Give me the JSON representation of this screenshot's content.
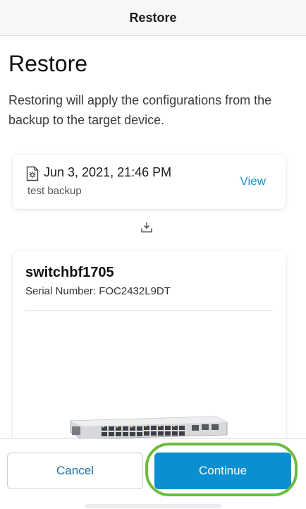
{
  "header": {
    "title": "Restore"
  },
  "page": {
    "title": "Restore",
    "description": "Restoring will apply the configurations from the backup to the target device."
  },
  "backup": {
    "date": "Jun 3, 2021, 21:46 PM",
    "name": "test backup",
    "view_label": "View",
    "icon": "document-icon"
  },
  "device": {
    "name": "switchbf1705",
    "serial": "Serial Number: FOC2432L9DT"
  },
  "footer": {
    "cancel_label": "Cancel",
    "continue_label": "Continue"
  },
  "colors": {
    "accent": "#0a8fd0",
    "link": "#1b8fc7",
    "highlight": "#6cbb3c"
  }
}
